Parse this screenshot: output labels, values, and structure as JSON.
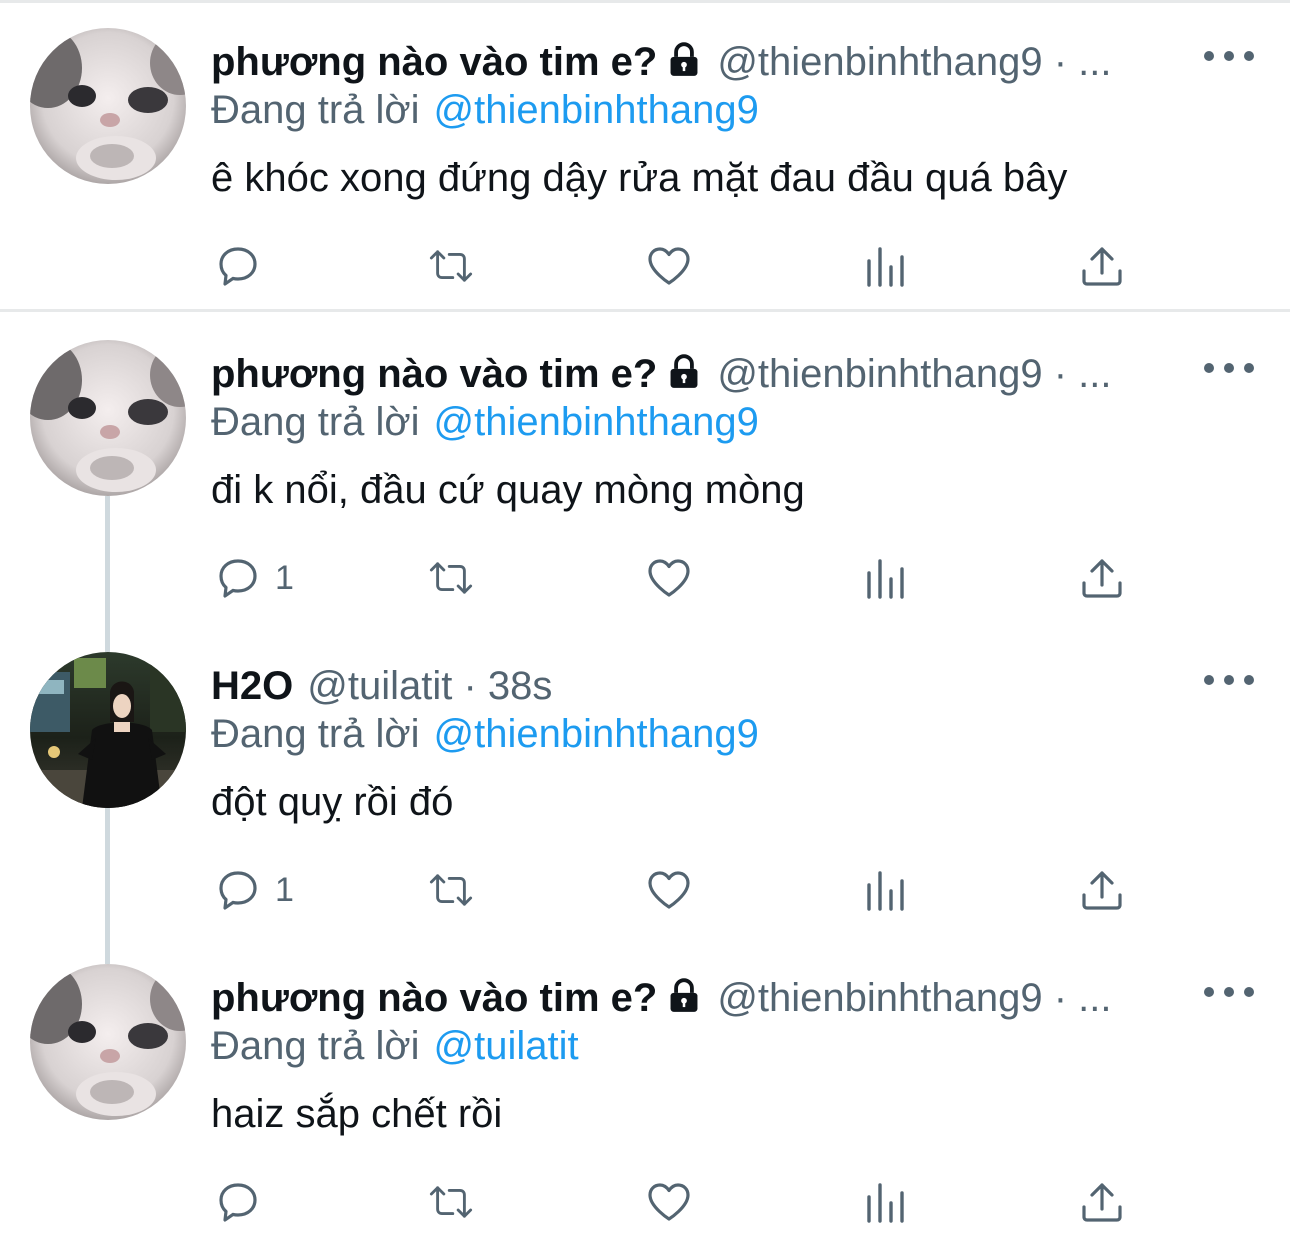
{
  "tweets": [
    {
      "name": "phương nào vào tim e?",
      "protected": true,
      "handle": "@thienbinhthang9",
      "time": "· ...",
      "reply_prefix": "Đang trả lời",
      "reply_to": "@thienbinhthang9",
      "text": "ê khóc xong đứng dậy rửa mặt đau đầu quá bây",
      "reply_count": ""
    },
    {
      "name": "phương nào vào tim e?",
      "protected": true,
      "handle": "@thienbinhthang9",
      "time": "· ...",
      "reply_prefix": "Đang trả lời",
      "reply_to": "@thienbinhthang9",
      "text": "đi k nổi, đầu cứ quay mòng mòng",
      "reply_count": "1"
    },
    {
      "name": "H2O",
      "protected": false,
      "handle": "@tuilatit",
      "time": "· 38s",
      "reply_prefix": "Đang trả lời",
      "reply_to": "@thienbinhthang9",
      "text": "đột quỵ rồi đó",
      "reply_count": "1"
    },
    {
      "name": "phương nào vào tim e?",
      "protected": true,
      "handle": "@thienbinhthang9",
      "time": "· ...",
      "reply_prefix": "Đang trả lời",
      "reply_to": "@tuilatit",
      "text": "haiz sắp chết rồi",
      "reply_count": ""
    }
  ],
  "icons": {
    "reply": "speech-bubble-icon",
    "retweet": "retweet-icon",
    "like": "heart-icon",
    "views": "bar-chart-icon",
    "share": "share-upload-icon",
    "more": "more-dots-icon",
    "lock": "lock-icon"
  },
  "colors": {
    "text": "#0f1419",
    "secondary": "#536471",
    "accent": "#1d9bf0",
    "divider": "#e7e9ea",
    "thread_line": "#cfd9de"
  }
}
